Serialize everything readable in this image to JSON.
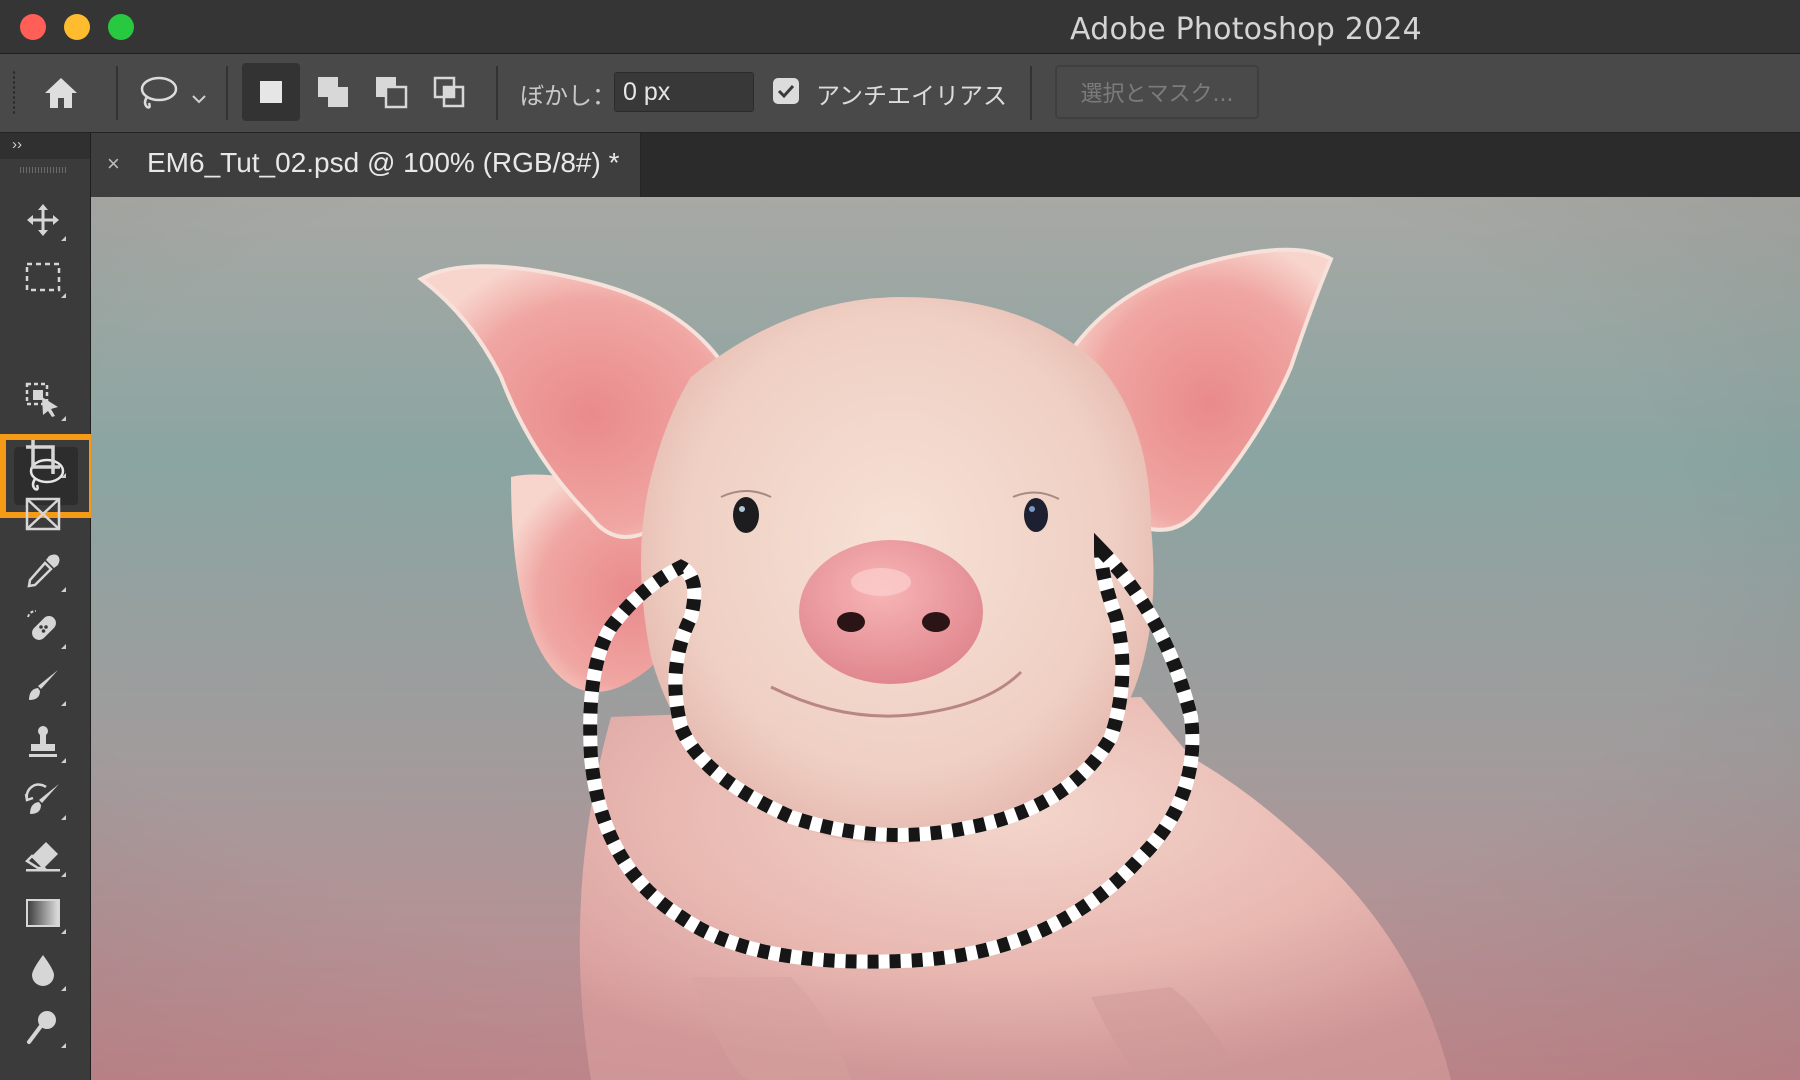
{
  "window": {
    "title": "Adobe Photoshop 2024",
    "traffic_lights": {
      "close": "#ff5f57",
      "minimize": "#febc2e",
      "zoom": "#28c840"
    }
  },
  "options_bar": {
    "home_icon": "home-icon",
    "tool_preset_icon": "lasso-icon",
    "selection_modes": [
      "new-selection-icon",
      "add-to-selection-icon",
      "subtract-from-selection-icon",
      "intersect-selection-icon"
    ],
    "active_mode_index": 0,
    "feather_label": "ぼかし：",
    "feather_value": "0 px",
    "anti_alias_checked": true,
    "anti_alias_label": "アンチエイリアス",
    "select_and_mask_label": "選択とマスク..."
  },
  "tools_panel": {
    "collapse_glyph": "››",
    "tools": [
      "move-tool",
      "rectangular-marquee-tool",
      "lasso-tool",
      "object-selection-tool",
      "crop-tool",
      "frame-tool",
      "eyedropper-tool",
      "spot-healing-brush-tool",
      "brush-tool",
      "clone-stamp-tool",
      "history-brush-tool",
      "eraser-tool",
      "gradient-tool",
      "blur-tool",
      "dodge-tool"
    ],
    "active_tool": "lasso-tool",
    "highlight_color": "#f59a16"
  },
  "document": {
    "tab_close": "×",
    "tab_title": "EM6_Tut_02.psd @ 100% (RGB/8#) *"
  },
  "canvas": {
    "image_subject": "piglet",
    "selection_outline": "marching-ants lasso selection"
  }
}
